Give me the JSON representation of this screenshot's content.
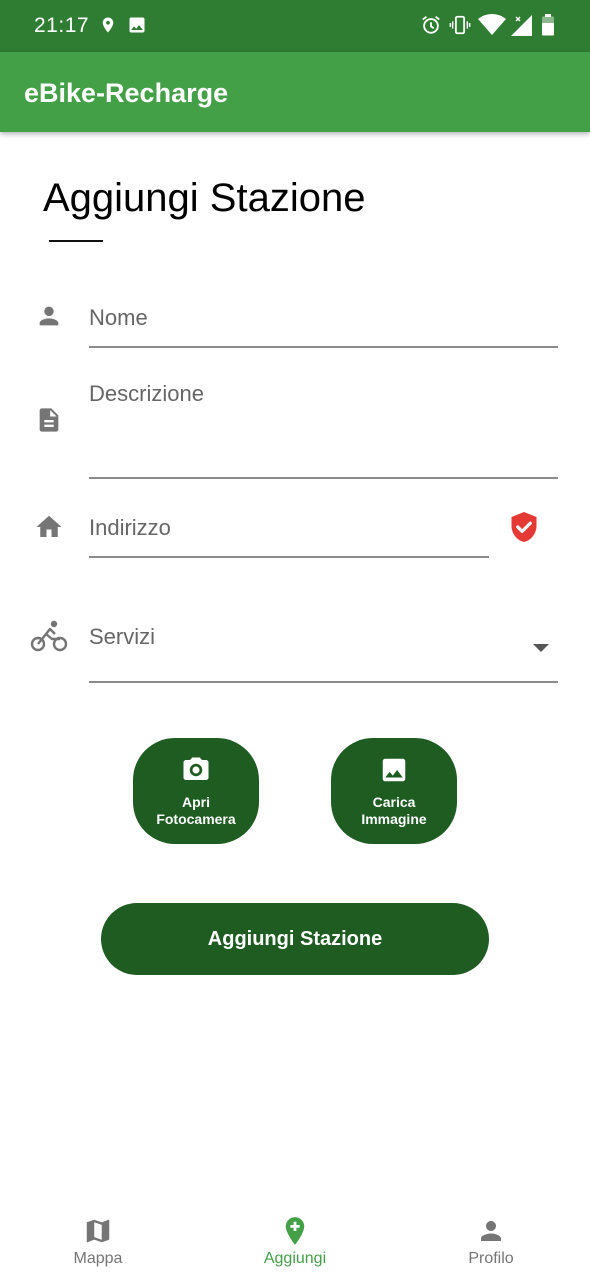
{
  "status_bar": {
    "time": "21:17",
    "icons_left": [
      "location-icon",
      "image-icon"
    ],
    "icons_right": [
      "alarm-icon",
      "vibrate-icon",
      "wifi-icon",
      "signal-icon",
      "battery-icon"
    ]
  },
  "app_bar": {
    "title": "eBike-Recharge"
  },
  "form": {
    "title": "Aggiungi Stazione",
    "fields": {
      "nome": {
        "placeholder": "Nome",
        "icon": "person-icon"
      },
      "descrizione": {
        "placeholder": "Descrizione",
        "icon": "document-icon"
      },
      "indirizzo": {
        "placeholder": "Indirizzo",
        "icon": "home-icon",
        "status_icon": "shield-check-icon"
      },
      "servizi": {
        "placeholder": "Servizi",
        "icon": "bike-icon"
      }
    },
    "camera_button": {
      "line1": "Apri",
      "line2": "Fotocamera",
      "icon": "camera-icon"
    },
    "upload_button": {
      "line1": "Carica",
      "line2": "Immagine",
      "icon": "image-icon"
    },
    "submit_label": "Aggiungi Stazione"
  },
  "bottom_nav": {
    "items": [
      {
        "label": "Mappa",
        "icon": "map-icon",
        "active": false
      },
      {
        "label": "Aggiungi",
        "icon": "add-location-icon",
        "active": true
      },
      {
        "label": "Profilo",
        "icon": "person-icon",
        "active": false
      }
    ]
  },
  "colors": {
    "status_bar": "#2e7d32",
    "app_bar": "#43a047",
    "button": "#1e5c22",
    "active_nav": "#43a047",
    "inactive_nav": "#757575",
    "shield": "#e53935"
  }
}
